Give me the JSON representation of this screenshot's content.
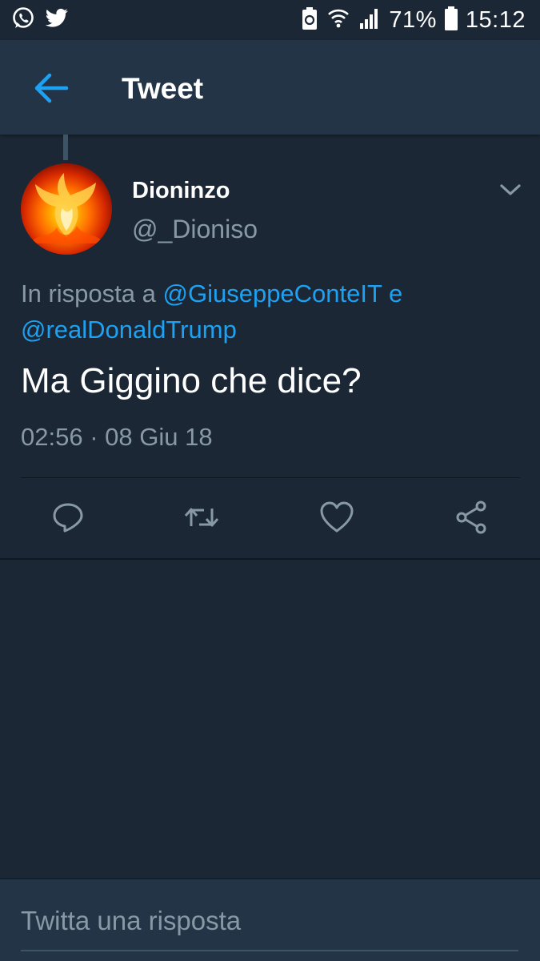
{
  "status_bar": {
    "battery": "71%",
    "time": "15:12",
    "icons": [
      "whatsapp-icon",
      "twitter-icon",
      "battery-saver-icon",
      "wifi-icon",
      "signal-icon",
      "battery-icon"
    ]
  },
  "header": {
    "title": "Tweet",
    "back_icon": "arrow-left-icon"
  },
  "tweet": {
    "author_name": "Dioninzo",
    "author_handle": "@_Dioniso",
    "reply_prefix": "In risposta a",
    "reply_mention_1": "@GiuseppeConteIT",
    "reply_conj": "e",
    "reply_mention_2": "@realDonaldTrump",
    "text": "Ma Giggino che dice?",
    "timestamp": "02:56 · 08 Giu 18",
    "actions": [
      "reply-icon",
      "retweet-icon",
      "like-icon",
      "share-icon"
    ]
  },
  "reply_bar": {
    "placeholder": "Twitta una risposta"
  },
  "colors": {
    "background": "#1b2735",
    "header": "#243447",
    "accent": "#1da1f2",
    "muted": "#8899a6"
  }
}
